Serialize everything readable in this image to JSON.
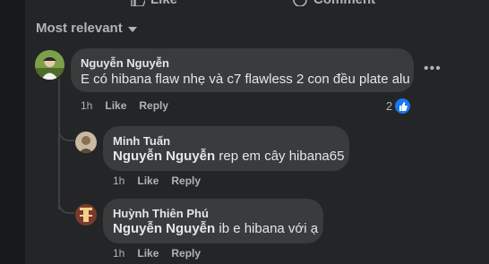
{
  "actions": {
    "like_label": "Like",
    "comment_label": "Comment"
  },
  "sort": {
    "label": "Most relevant"
  },
  "comment": {
    "author": "Nguyễn Nguyễn",
    "text": "E có hibana flaw nhẹ và c7 flawless 2 con đều plate alu",
    "time": "1h",
    "like_label": "Like",
    "reply_label": "Reply",
    "reaction_count": "2"
  },
  "replies": [
    {
      "author": "Minh Tuấn",
      "mention": "Nguyễn Nguyễn",
      "text": " rep em cây hibana65",
      "time": "1h",
      "like_label": "Like",
      "reply_label": "Reply"
    },
    {
      "author": "Huỳnh Thiên Phú",
      "mention": "Nguyễn Nguyễn",
      "text": " ib e hibana với ạ",
      "time": "1h",
      "like_label": "Like",
      "reply_label": "Reply"
    }
  ],
  "colors": {
    "background": "#242526",
    "bubble": "#3a3b3c",
    "accent": "#1877f2"
  }
}
